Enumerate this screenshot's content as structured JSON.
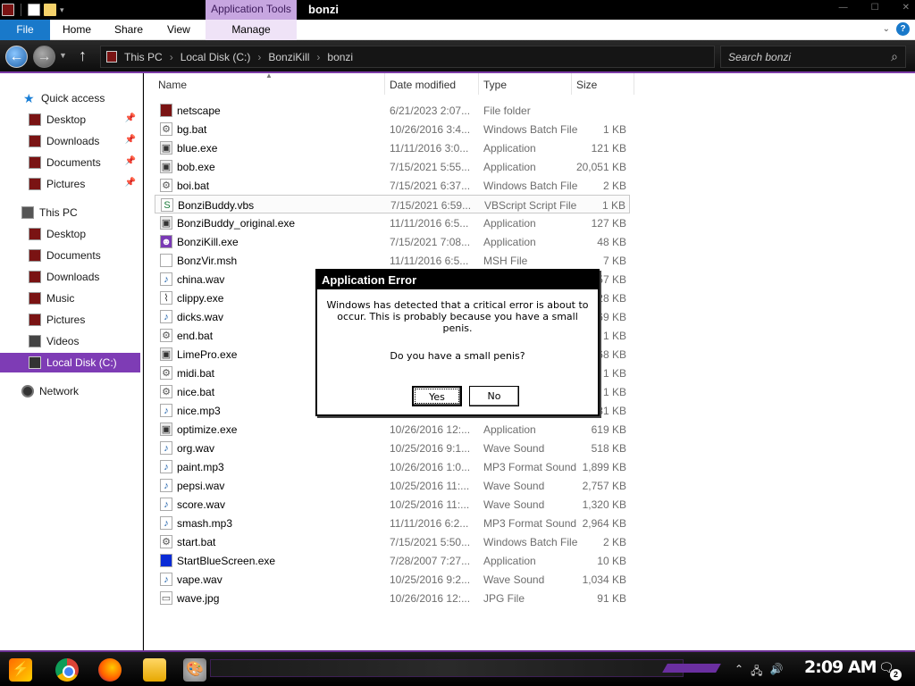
{
  "window": {
    "title": "bonzi",
    "context_tab": "Application Tools",
    "controls": [
      "—",
      "☐",
      "✕"
    ]
  },
  "ribbon": {
    "file": "File",
    "tabs": [
      "Home",
      "Share",
      "View"
    ],
    "manage": "Manage"
  },
  "address": {
    "crumbs": [
      "This PC",
      "Local Disk (C:)",
      "BonziKill",
      "bonzi"
    ],
    "search_placeholder": "Search bonzi"
  },
  "sidebar": {
    "quick_access": "Quick access",
    "quick_items": [
      "Desktop",
      "Downloads",
      "Documents",
      "Pictures"
    ],
    "this_pc": "This PC",
    "pc_items": [
      "Desktop",
      "Documents",
      "Downloads",
      "Music",
      "Pictures",
      "Videos",
      "Local Disk (C:)"
    ],
    "network": "Network"
  },
  "columns": [
    "Name",
    "Date modified",
    "Type",
    "Size"
  ],
  "files": [
    {
      "name": "netscape",
      "date": "6/21/2023 2:07...",
      "type": "File folder",
      "size": "",
      "icon": "folder-icon"
    },
    {
      "name": "bg.bat",
      "date": "10/26/2016 3:4...",
      "type": "Windows Batch File",
      "size": "1 KB",
      "icon": "batch-file-icon"
    },
    {
      "name": "blue.exe",
      "date": "11/11/2016 3:0...",
      "type": "Application",
      "size": "121 KB",
      "icon": "app-icon"
    },
    {
      "name": "bob.exe",
      "date": "7/15/2021 5:55...",
      "type": "Application",
      "size": "20,051 KB",
      "icon": "app-icon"
    },
    {
      "name": "boi.bat",
      "date": "7/15/2021 6:37...",
      "type": "Windows Batch File",
      "size": "2 KB",
      "icon": "batch-file-icon"
    },
    {
      "name": "BonziBuddy.vbs",
      "date": "7/15/2021 6:59...",
      "type": "VBScript Script File",
      "size": "1 KB",
      "icon": "script-file-icon"
    },
    {
      "name": "BonziBuddy_original.exe",
      "date": "11/11/2016 6:5...",
      "type": "Application",
      "size": "127 KB",
      "icon": "app-icon"
    },
    {
      "name": "BonziKill.exe",
      "date": "7/15/2021 7:08...",
      "type": "Application",
      "size": "48 KB",
      "icon": "bonzi-icon"
    },
    {
      "name": "BonzVir.msh",
      "date": "11/11/2016 6:5...",
      "type": "MSH File",
      "size": "7 KB",
      "icon": "blank-file-icon"
    },
    {
      "name": "china.wav",
      "date": "",
      "type": "",
      "size": "757 KB",
      "icon": "audio-file-icon"
    },
    {
      "name": "clippy.exe",
      "date": "",
      "type": "",
      "size": "228 KB",
      "icon": "paperclip-icon"
    },
    {
      "name": "dicks.wav",
      "date": "",
      "type": "",
      "size": "169 KB",
      "icon": "audio-file-icon"
    },
    {
      "name": "end.bat",
      "date": "",
      "type": "",
      "size": "1 KB",
      "icon": "batch-file-icon"
    },
    {
      "name": "LimePro.exe",
      "date": "",
      "type": "",
      "size": "168 KB",
      "icon": "app-icon"
    },
    {
      "name": "midi.bat",
      "date": "",
      "type": "",
      "size": "1 KB",
      "icon": "batch-file-icon"
    },
    {
      "name": "nice.bat",
      "date": "",
      "type": "",
      "size": "1 KB",
      "icon": "batch-file-icon"
    },
    {
      "name": "nice.mp3",
      "date": "",
      "type": "",
      "size": "481 KB",
      "icon": "audio-file-icon"
    },
    {
      "name": "optimize.exe",
      "date": "10/26/2016 12:...",
      "type": "Application",
      "size": "619 KB",
      "icon": "app-icon"
    },
    {
      "name": "org.wav",
      "date": "10/25/2016 9:1...",
      "type": "Wave Sound",
      "size": "518 KB",
      "icon": "audio-file-icon"
    },
    {
      "name": "paint.mp3",
      "date": "10/26/2016 1:0...",
      "type": "MP3 Format Sound",
      "size": "1,899 KB",
      "icon": "audio-file-icon"
    },
    {
      "name": "pepsi.wav",
      "date": "10/25/2016 11:...",
      "type": "Wave Sound",
      "size": "2,757 KB",
      "icon": "audio-file-icon"
    },
    {
      "name": "score.wav",
      "date": "10/25/2016 11:...",
      "type": "Wave Sound",
      "size": "1,320 KB",
      "icon": "audio-file-icon"
    },
    {
      "name": "smash.mp3",
      "date": "11/11/2016 6:2...",
      "type": "MP3 Format Sound",
      "size": "2,964 KB",
      "icon": "audio-file-icon"
    },
    {
      "name": "start.bat",
      "date": "7/15/2021 5:50...",
      "type": "Windows Batch File",
      "size": "2 KB",
      "icon": "batch-file-icon"
    },
    {
      "name": "StartBlueScreen.exe",
      "date": "7/28/2007 7:27...",
      "type": "Application",
      "size": "10 KB",
      "icon": "bluescreen-icon"
    },
    {
      "name": "vape.wav",
      "date": "10/25/2016 9:2...",
      "type": "Wave Sound",
      "size": "1,034 KB",
      "icon": "audio-file-icon"
    },
    {
      "name": "wave.jpg",
      "date": "10/26/2016 12:...",
      "type": "JPG File",
      "size": "91 KB",
      "icon": "image-file-icon"
    }
  ],
  "dialog": {
    "title": "Application Error",
    "message": "Windows has detected that a critical error is about to occur. This is probably because you have a small penis.",
    "question": "Do you have a small penis?",
    "yes": "Yes",
    "no": "No"
  },
  "taskbar": {
    "clock": "2:09 AM",
    "notification_count": "2"
  },
  "colors": {
    "accent_purple": "#7e3cb5",
    "file_tab_blue": "#1979ca",
    "context_tab": "#c7a6e0"
  }
}
